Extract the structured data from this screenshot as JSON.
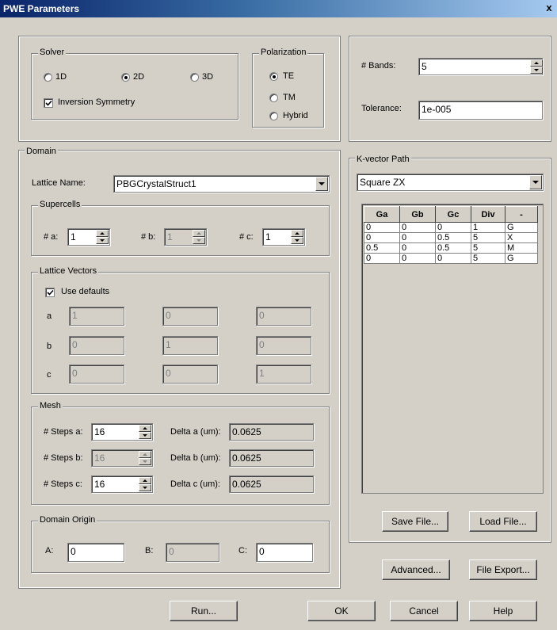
{
  "window": {
    "title": "PWE Parameters",
    "close": "x"
  },
  "solver": {
    "legend": "Solver",
    "options": [
      {
        "label": "1D",
        "selected": false
      },
      {
        "label": "2D",
        "selected": true
      },
      {
        "label": "3D",
        "selected": false
      }
    ],
    "inversion_symmetry": {
      "label": "Inversion Symmetry",
      "checked": true
    }
  },
  "polarization": {
    "legend": "Polarization",
    "options": [
      {
        "label": "TE",
        "selected": true
      },
      {
        "label": "TM",
        "selected": false
      },
      {
        "label": "Hybrid",
        "selected": false
      }
    ]
  },
  "bands": {
    "label": "# Bands:",
    "value": "5"
  },
  "tolerance": {
    "label": "Tolerance:",
    "value": "1e-005"
  },
  "domain": {
    "legend": "Domain",
    "lattice_name": {
      "label": "Lattice Name:",
      "value": "PBGCrystalStruct1"
    },
    "supercells": {
      "legend": "Supercells",
      "a": {
        "label": "# a:",
        "value": "1"
      },
      "b": {
        "label": "# b:",
        "value": "1"
      },
      "c": {
        "label": "# c:",
        "value": "1"
      }
    },
    "lattice_vectors": {
      "legend": "Lattice Vectors",
      "use_defaults": {
        "label": "Use defaults",
        "checked": true
      },
      "rows": [
        {
          "label": "a",
          "values": [
            "1",
            "0",
            "0"
          ]
        },
        {
          "label": "b",
          "values": [
            "0",
            "1",
            "0"
          ]
        },
        {
          "label": "c",
          "values": [
            "0",
            "0",
            "1"
          ]
        }
      ]
    },
    "mesh": {
      "legend": "Mesh",
      "steps_a": {
        "label": "# Steps a:",
        "value": "16"
      },
      "steps_b": {
        "label": "# Steps b:",
        "value": "16"
      },
      "steps_c": {
        "label": "# Steps c:",
        "value": "16"
      },
      "delta_a": {
        "label": "Delta a (um):",
        "value": "0.0625"
      },
      "delta_b": {
        "label": "Delta b (um):",
        "value": "0.0625"
      },
      "delta_c": {
        "label": "Delta c (um):",
        "value": "0.0625"
      }
    },
    "origin": {
      "legend": "Domain Origin",
      "a": {
        "label": "A:",
        "value": "0"
      },
      "b": {
        "label": "B:",
        "value": "0"
      },
      "c": {
        "label": "C:",
        "value": "0"
      }
    }
  },
  "kpath": {
    "legend": "K-vector Path",
    "preset": "Square ZX",
    "headers": [
      "Ga",
      "Gb",
      "Gc",
      "Div",
      "-"
    ],
    "rows": [
      [
        "0",
        "0",
        "0",
        "1",
        "G"
      ],
      [
        "0",
        "0",
        "0.5",
        "5",
        "X"
      ],
      [
        "0.5",
        "0",
        "0.5",
        "5",
        "M"
      ],
      [
        "0",
        "0",
        "0",
        "5",
        "G"
      ]
    ],
    "save": "Save File...",
    "load": "Load File..."
  },
  "buttons": {
    "advanced": "Advanced...",
    "file_export": "File Export...",
    "run": "Run...",
    "ok": "OK",
    "cancel": "Cancel",
    "help": "Help"
  }
}
